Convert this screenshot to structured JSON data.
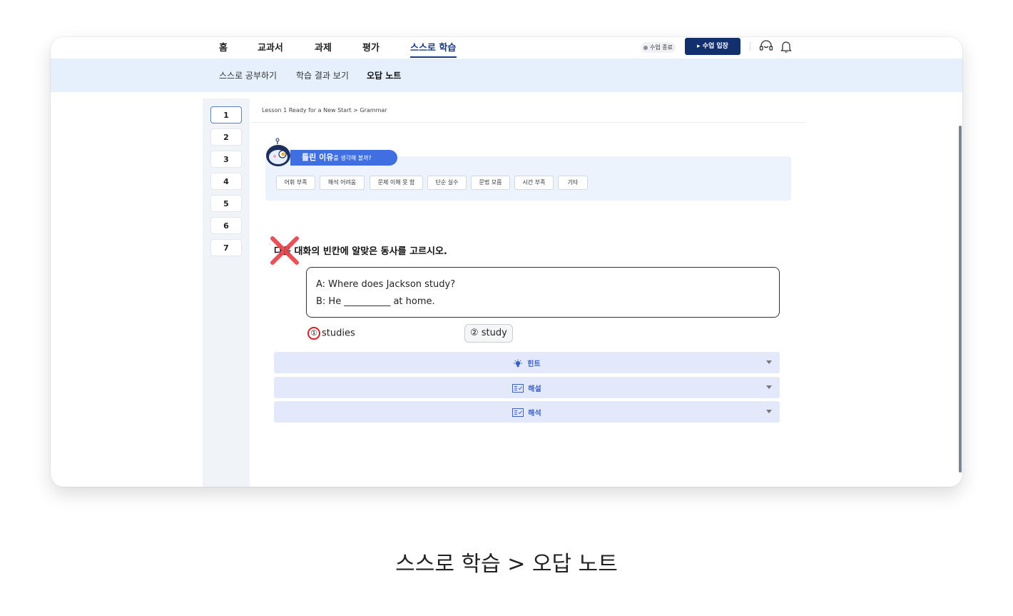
{
  "nav": {
    "items": [
      "홈",
      "교과서",
      "과제",
      "평가",
      "스스로 학습"
    ],
    "active_index": 4,
    "status_label": "수업 종료",
    "enter_button": "▸ 수업 입장",
    "headset_icon": "headset-icon",
    "bell_icon": "bell-icon"
  },
  "subnav": {
    "items": [
      "스스로 공부하기",
      "학습 결과 보기",
      "오답 노트"
    ],
    "active_index": 2
  },
  "question_numbers": [
    "1",
    "2",
    "3",
    "4",
    "5",
    "6",
    "7"
  ],
  "breadcrumb": "Lesson 1 Ready for a New Start > Grammar",
  "reason": {
    "title_bold": "틀린 이유",
    "title_rest": "를 생각해 볼까?",
    "chips": [
      "어휘 부족",
      "해석 어려움",
      "문제 이해 못 함",
      "단순 실수",
      "문법 모름",
      "시간 부족",
      "기타"
    ]
  },
  "question": {
    "text": "다음 대화의 빈칸에 알맞은 동사를 고르시오.",
    "dialog_a": "A: Where does Jackson study?",
    "dialog_b": "B: He __________ at home.",
    "option1_num": "①",
    "option1_text": "studies",
    "option2": "② study"
  },
  "accordions": [
    {
      "label": "힌트",
      "icon": "lightbulb-icon"
    },
    {
      "label": "해설",
      "icon": "checklist-icon"
    },
    {
      "label": "해석",
      "icon": "checklist-icon"
    }
  ],
  "colors": {
    "accent": "#1b3a8c",
    "subnav_bg": "#e6f0fd",
    "wrong_mark": "#e8434b",
    "accordion_bg": "#e3e9fb"
  },
  "caption": "스스로 학습 > 오답 노트"
}
